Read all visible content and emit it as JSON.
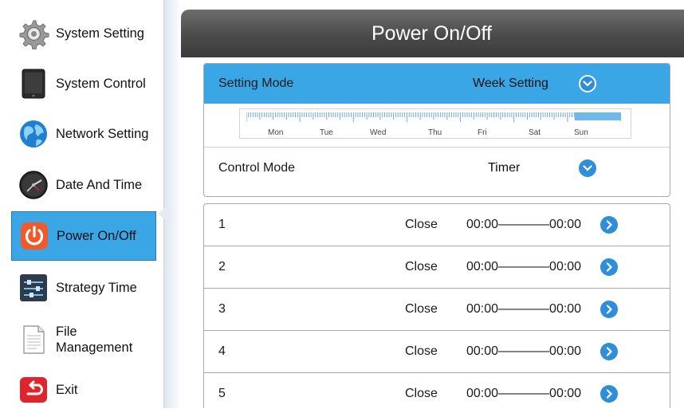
{
  "sidebar": {
    "items": [
      {
        "label": "System Setting",
        "icon": "gear-icon"
      },
      {
        "label": "System Control",
        "icon": "tablet-icon"
      },
      {
        "label": "Network Setting",
        "icon": "globe-icon"
      },
      {
        "label": "Date And Time",
        "icon": "clock-icon"
      },
      {
        "label": "Power On/Off",
        "icon": "power-icon",
        "active": true
      },
      {
        "label": "Strategy Time",
        "icon": "sliders-icon"
      },
      {
        "label": "File Management",
        "label_line1": "File",
        "label_line2": "Management",
        "icon": "file-icon"
      },
      {
        "label": "Exit",
        "icon": "exit-icon"
      }
    ]
  },
  "header": {
    "title": "Power On/Off"
  },
  "setting_mode": {
    "label": "Setting Mode",
    "value": "Week Setting"
  },
  "week": {
    "days": [
      "Mon",
      "Tue",
      "Wed",
      "Thu",
      "Fri",
      "Sat",
      "Sun"
    ],
    "highlighted_day": "Sun"
  },
  "control_mode": {
    "label": "Control Mode",
    "value": "Timer"
  },
  "timers": [
    {
      "index": "1",
      "status": "Close",
      "range": "00:00————00:00"
    },
    {
      "index": "2",
      "status": "Close",
      "range": "00:00————00:00"
    },
    {
      "index": "3",
      "status": "Close",
      "range": "00:00————00:00"
    },
    {
      "index": "4",
      "status": "Close",
      "range": "00:00————00:00"
    },
    {
      "index": "5",
      "status": "Close",
      "range": "00:00————00:00"
    }
  ],
  "colors": {
    "accent": "#3aa6e6",
    "title_bar": "#4a4a4a",
    "button": "#2e8fd8",
    "power_icon": "#f05a2a",
    "exit_icon": "#e0242c"
  }
}
